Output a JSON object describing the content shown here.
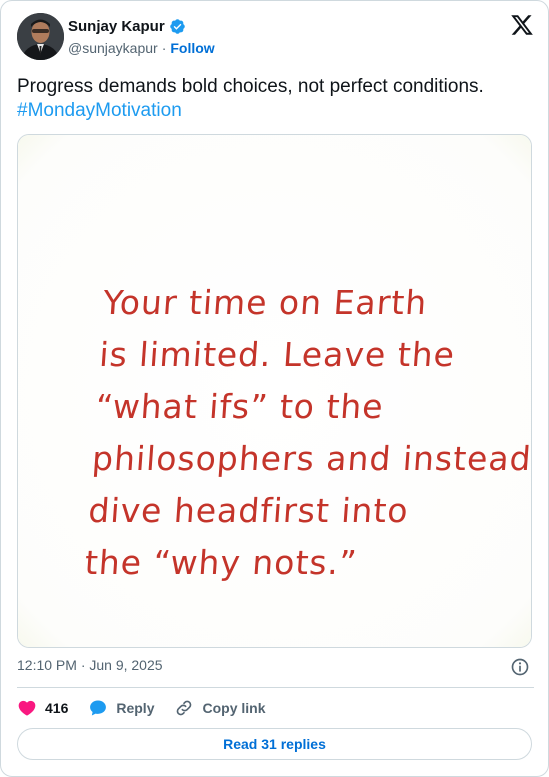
{
  "author": {
    "display_name": "Sunjay Kapur",
    "handle": "@sunjaykapur",
    "separator": "·",
    "follow_label": "Follow",
    "verified": true
  },
  "tweet": {
    "text": "Progress demands bold choices, not perfect conditions.",
    "hashtag": "#MondayMotivation"
  },
  "media": {
    "quote_lines": [
      "Your time on Earth",
      "is limited. Leave the",
      "“what ifs” to the",
      "philosophers and instead",
      "dive headfirst into",
      "the “why nots.”"
    ],
    "text_color": "#c4342a"
  },
  "timestamp": "12:10 PM · Jun 9, 2025",
  "actions": {
    "like_count": "416",
    "reply_label": "Reply",
    "copy_link_label": "Copy link"
  },
  "read_replies_label": "Read 31 replies",
  "colors": {
    "link_blue": "#1d9bf0",
    "follow_blue": "#006fd6",
    "heart_pink": "#f91880",
    "border": "#cfd9de",
    "muted": "#536471"
  },
  "icons": [
    "verified-badge-icon",
    "x-logo-icon",
    "info-icon",
    "heart-icon",
    "reply-bubble-icon",
    "link-icon"
  ]
}
